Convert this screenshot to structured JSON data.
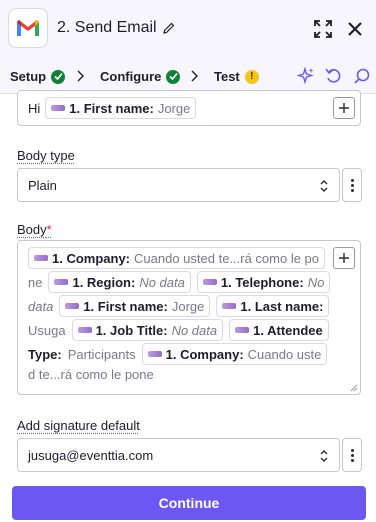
{
  "header": {
    "title": "2. Send Email",
    "app_icon": "gmail-icon",
    "edit_icon": "pencil-icon",
    "expand_icon": "expand-icon",
    "close_icon": "close-icon"
  },
  "tabs": [
    {
      "label": "Setup",
      "status": "complete"
    },
    {
      "label": "Configure",
      "status": "complete",
      "active": true
    },
    {
      "label": "Test",
      "status": "warning",
      "status_text": "!"
    }
  ],
  "toolbar_icons": [
    "sparkle-icon",
    "undo-icon",
    "search-icon"
  ],
  "subject_field": {
    "prefix": "Hi",
    "pill": {
      "label": "1. First name:",
      "value": "Jorge"
    }
  },
  "body_type": {
    "label": "Body type",
    "value": "Plain"
  },
  "body": {
    "label": "Body",
    "required_mark": "*",
    "lines": [
      [
        {
          "type": "pill",
          "label": "1. Company:",
          "value": "Cuando usted te...rá como le po",
          "italic": false
        }
      ],
      [
        {
          "type": "text",
          "text": "ne"
        },
        {
          "type": "pill",
          "label": "1. Region:",
          "value": "No data",
          "italic": true
        },
        {
          "type": "pill",
          "label": "1. Telephone:",
          "value": "No",
          "italic": true
        }
      ],
      [
        {
          "type": "text",
          "text": "data",
          "italic": true
        },
        {
          "type": "pill",
          "label": "1. First name:",
          "value": "Jorge",
          "italic": false
        },
        {
          "type": "pill",
          "label": "1. Last name:",
          "value": "",
          "italic": false
        }
      ],
      [
        {
          "type": "text",
          "text": "Usuga"
        },
        {
          "type": "pill",
          "label": "1. Job Title:",
          "value": "No data",
          "italic": true
        },
        {
          "type": "pill",
          "label": "1. Attendee",
          "value": "",
          "italic": false
        }
      ],
      [
        {
          "type": "bold",
          "text": "Type:"
        },
        {
          "type": "text",
          "text": "Participants"
        },
        {
          "type": "pill",
          "label": "1. Company:",
          "value": "Cuando uste",
          "italic": false
        }
      ],
      [
        {
          "type": "text",
          "text": "d te...rá como le pone"
        }
      ]
    ]
  },
  "signature": {
    "label": "Add signature default",
    "value": "jusuga@eventtia.com"
  },
  "continue_label": "Continue",
  "colors": {
    "accent": "#6d57f2",
    "success": "#13803a",
    "warning": "#f5c518",
    "header_bg": "#f7f6fd"
  }
}
